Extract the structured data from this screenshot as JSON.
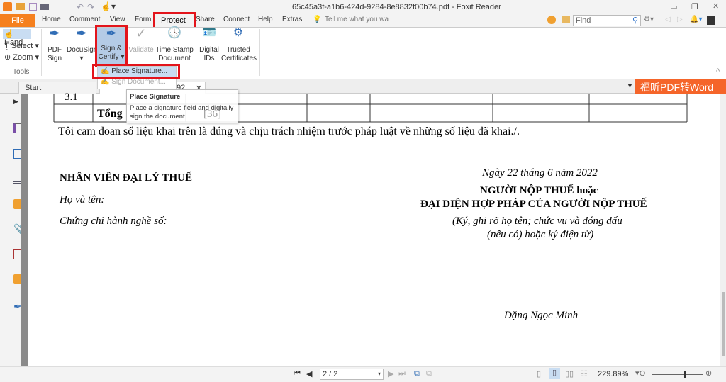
{
  "window": {
    "title": "65c45a3f-a1b6-424d-9284-8e8832f00b74.pdf - Foxit Reader"
  },
  "menu": {
    "file": "File",
    "tabs": [
      "Home",
      "Comment",
      "View",
      "Form",
      "Protect",
      "Share",
      "Connect",
      "Help",
      "Extras"
    ],
    "tell_me": "Tell me what you wa",
    "find_placeholder": "Find"
  },
  "ribbon": {
    "hand": "Hand",
    "select": "Select",
    "zoom": "Zoom",
    "tools_group": "Tools",
    "buttons": [
      {
        "l1": "PDF",
        "l2": "Sign"
      },
      {
        "l1": "DocuSign",
        "l2": ""
      },
      {
        "l1": "Sign &",
        "l2": "Certify"
      },
      {
        "l1": "Validate",
        "l2": ""
      },
      {
        "l1": "Time Stamp",
        "l2": "Document"
      },
      {
        "l1": "Digital",
        "l2": "IDs"
      },
      {
        "l1": "Trusted",
        "l2": "Certificates"
      }
    ]
  },
  "dropdown": {
    "items": [
      "Place Signature...",
      "Sign Document..."
    ]
  },
  "tooltip": {
    "title": "Place Signature",
    "body": "Place a signature field and digitally sign the document"
  },
  "tabs": {
    "start": "Start",
    "doc_tail": "92"
  },
  "promo": "福昕PDF转Word",
  "doc": {
    "row1": "3.1",
    "row2": "Tổng",
    "row2_val": "[36]",
    "commit": "Tôi cam đoan số liệu khai trên là đúng và chịu trách nhiệm trước pháp luật về những số liệu đã khai./.",
    "left_title": "NHÂN VIÊN ĐẠI LÝ THUẾ",
    "left_name": "Họ và tên:",
    "left_cert": "Chứng chỉ hành nghề số:",
    "date": "Ngày 22 tháng 6 năm 2022",
    "right_t1": "NGƯỜI NỘP THUẾ hoặc",
    "right_t2": "ĐẠI DIỆN HỢP PHÁP CỦA NGƯỜI NỘP THUẾ",
    "right_n1": "(Ký, ghi rõ họ tên; chức vụ và đóng dấu",
    "right_n2": "(nếu có) hoặc ký điện tử)",
    "signer": "Đặng Ngọc Minh"
  },
  "status": {
    "page": "2 / 2",
    "zoom": "229.89%",
    "zoom_slider": 0.62
  },
  "colors": {
    "accent": "#f5801f",
    "highlight": "#e3141b"
  }
}
